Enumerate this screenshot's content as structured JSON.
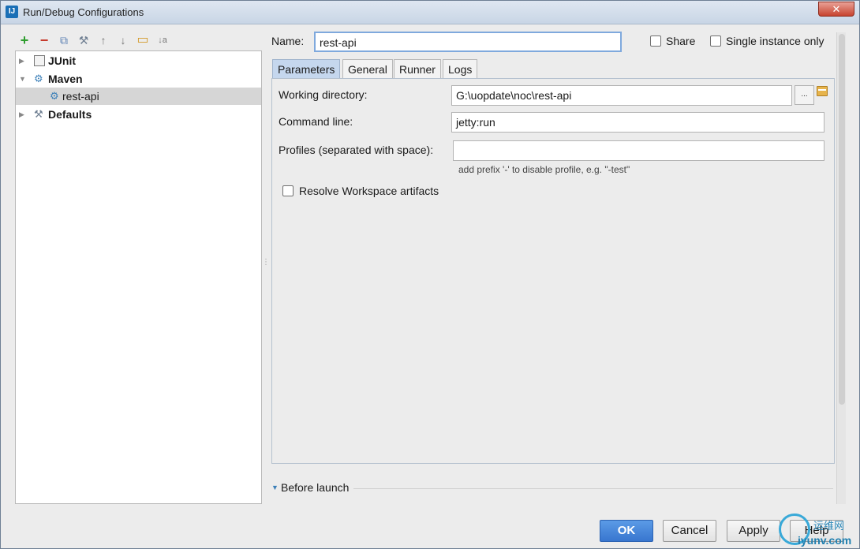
{
  "window": {
    "title": "Run/Debug Configurations",
    "app_icon": "IJ",
    "close_glyph": "✕"
  },
  "toolbar": {
    "add_icon": "+",
    "remove_icon": "−",
    "copy_icon": "⧉",
    "edit_defaults_icon": "⚒",
    "move_up_icon": "↑",
    "move_down_icon": "↓",
    "folder_icon": "▭",
    "sort_icon": "↓a"
  },
  "tree": {
    "items": [
      {
        "label": "JUnit",
        "expanded": false,
        "bold": true
      },
      {
        "label": "Maven",
        "expanded": true,
        "bold": true
      },
      {
        "label": "rest-api",
        "child": true,
        "selected": true
      },
      {
        "label": "Defaults",
        "expanded": false,
        "bold": true
      }
    ]
  },
  "form": {
    "name_label": "Name:",
    "name_value": "rest-api",
    "share_label": "Share",
    "single_instance_label": "Single instance only"
  },
  "tabs": [
    {
      "label": "Parameters",
      "active": true
    },
    {
      "label": "General"
    },
    {
      "label": "Runner"
    },
    {
      "label": "Logs"
    }
  ],
  "parameters": {
    "working_dir_label": "Working directory:",
    "working_dir_value": "G:\\uopdate\\noc\\rest-api",
    "browse_label": "...",
    "command_line_label": "Command line:",
    "command_line_value": "jetty:run",
    "profiles_label": "Profiles (separated with space):",
    "profiles_value": "",
    "profiles_hint": "add prefix '-' to disable profile, e.g. \"-test\"",
    "resolve_workspace_label": "Resolve Workspace artifacts"
  },
  "before_launch": {
    "label": "Before launch"
  },
  "buttons": {
    "ok": "OK",
    "cancel": "Cancel",
    "apply": "Apply",
    "help": "Help"
  },
  "watermark": {
    "cn_text": "运维网",
    "url": "iyunv.com"
  },
  "colors": {
    "accent": "#3876cf",
    "active_tab": "#c5d7ee",
    "selection": "#d6d6d6"
  }
}
